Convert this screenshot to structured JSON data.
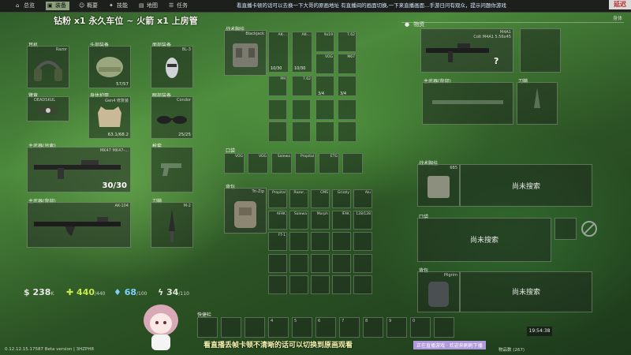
{
  "topbar": {
    "tabs": [
      {
        "icon": "house-icon",
        "label": "总览"
      },
      {
        "icon": "backpack-icon",
        "label": "装备"
      },
      {
        "icon": "person-icon",
        "label": "概要"
      },
      {
        "icon": "skill-icon",
        "label": "技能"
      },
      {
        "icon": "map-icon",
        "label": "地图"
      },
      {
        "icon": "task-icon",
        "label": "任务"
      }
    ],
    "marquee": "看直播卡顿的话可以去换一下大哥的原画地址 有直播间的画面切换,一下来直播画面...手游日问有观众，提示问题你游戏",
    "exit_label": "延迟"
  },
  "title_line": "钻粉 x1 永久车位 ~ 火箭 x1 上房管",
  "gear": {
    "earpiece": {
      "label": "耳机",
      "name": "Razor"
    },
    "headwear": {
      "label": "头部装备",
      "value": "57/57"
    },
    "face_cover": {
      "label": "面部装备",
      "name": "BL-3"
    },
    "armband": {
      "label": "臂章",
      "name": "DEADSKUL"
    },
    "body_armor": {
      "label": "身体护甲",
      "name": "Gen4 修复装",
      "value": "63.1/68.2"
    },
    "eyewear": {
      "label": "眼部装备",
      "name": "Condor",
      "value": "25/25"
    },
    "primary": {
      "label": "主武器(吊索)",
      "name": "MK47 MK47-...",
      "value": "30/30"
    },
    "holster": {
      "label": "枪套"
    },
    "secondary": {
      "label": "主武器(背部)",
      "name": "AK-104"
    },
    "scabbard": {
      "label": "刀鞘",
      "name": "M-2"
    }
  },
  "stats": [
    {
      "icon": "money-icon",
      "value": "238",
      "unit": "K",
      "color": "#e8e8e8"
    },
    {
      "icon": "health-icon",
      "value": "440",
      "unit": "/440",
      "color": "#c9e84a"
    },
    {
      "icon": "water-icon",
      "value": "68",
      "unit": "/100",
      "color": "#7ad0ff"
    },
    {
      "icon": "energy-icon",
      "value": "34",
      "unit": "/110",
      "color": "#dfe3d6"
    }
  ],
  "middle": {
    "rig_label": "战术胸挂",
    "rig_name": "Blackjack",
    "rig_items": [
      "AK-...",
      "AK-...",
      "9x19",
      "7.62",
      "VOG",
      "M67",
      "PM",
      "7.62"
    ],
    "rig_values": [
      "10/30",
      "10/30",
      "3/4",
      "3/4"
    ],
    "pockets_label": "口袋",
    "pockets_items": [
      "VOG",
      "VOG",
      "Salewa",
      "Propital",
      "ETG"
    ],
    "backpack_label": "背包",
    "backpack_name": "Tri-Zip",
    "backpack_items": [
      "Propital",
      "Razor...",
      "CMS",
      "Grizzly",
      "Alu",
      "AFAK",
      "Salewa",
      "Morph",
      "IFAK",
      "128/128",
      "FT-1"
    ]
  },
  "loot": {
    "header": "物资",
    "body_label": "身体",
    "primary_label": "主武器(背部)",
    "scabbard_label": "刀鞘",
    "weapon_name": "M4A1",
    "weapon_desc": "Colt M4A1 5.56x45",
    "weapon_badge": "?",
    "rig_label": "战术胸挂",
    "rig_name": "6B5",
    "rig_status": "尚未搜索",
    "pockets_label": "口袋",
    "pockets_status": "尚未搜索",
    "backpack_label": "背包",
    "backpack_name": "Pilgrim",
    "backpack_status": "尚未搜索"
  },
  "bottom": {
    "quick_label": "快捷栏",
    "quick_slots": [
      "4",
      "5",
      "6",
      "7",
      "8",
      "9",
      "0"
    ],
    "time": "19:54:38",
    "version": "0.12.12.15.17587 Beta version | 3HZPH8",
    "subtitle": "看直播丢帧卡顿不清晰的话可以切换到原画观看",
    "tag": "正在直播游戏 · 欢迎来刷刷下播",
    "item_count": "物品数 (267)"
  }
}
